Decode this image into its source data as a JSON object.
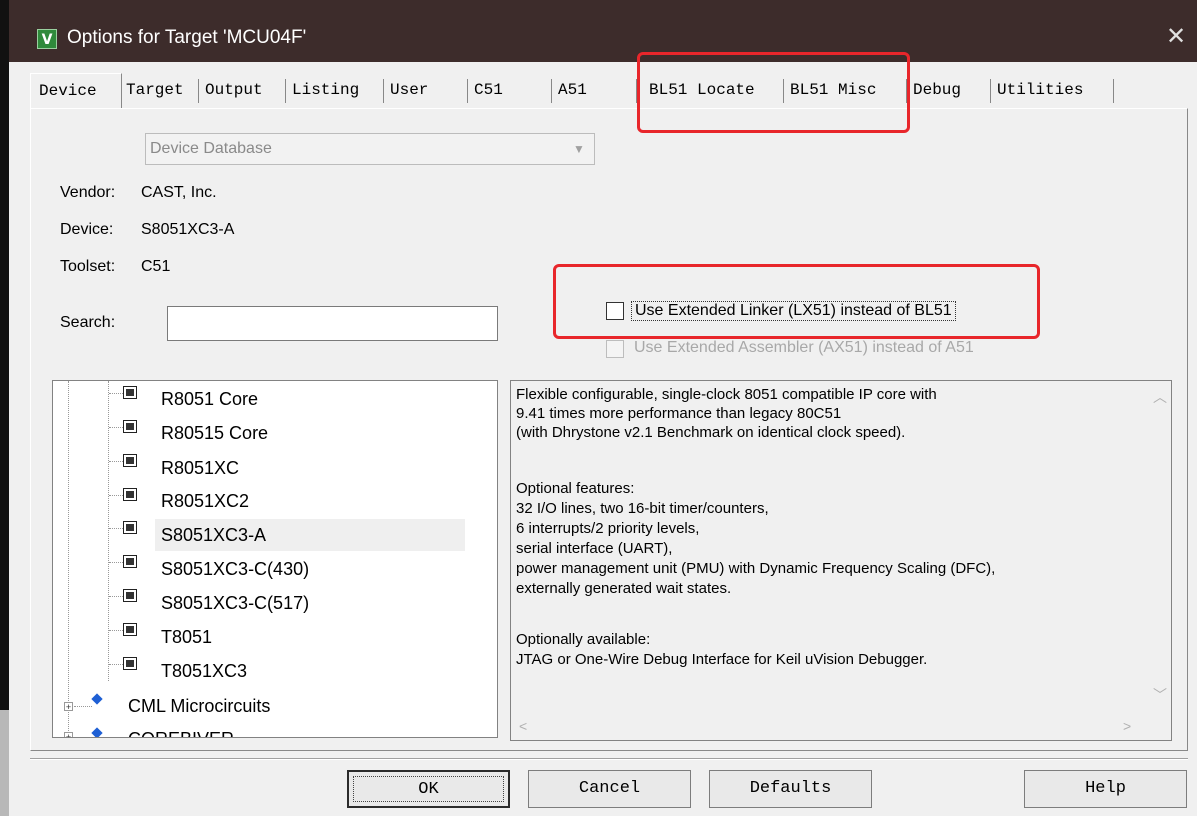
{
  "window": {
    "title": "Options for Target 'MCU04F'",
    "close_glyph": "✕",
    "icon_letter": "V"
  },
  "tabs": [
    {
      "label": "Device"
    },
    {
      "label": "Target"
    },
    {
      "label": "Output"
    },
    {
      "label": "Listing"
    },
    {
      "label": "User"
    },
    {
      "label": "C51"
    },
    {
      "label": "A51"
    },
    {
      "label": "BL51 Locate"
    },
    {
      "label": "BL51 Misc"
    },
    {
      "label": "Debug"
    },
    {
      "label": "Utilities"
    }
  ],
  "device": {
    "database_combo": "Device Database",
    "vendor_label": "Vendor:",
    "vendor_value": "CAST, Inc.",
    "device_label": "Device:",
    "device_value": "S8051XC3-A",
    "toolset_label": "Toolset:",
    "toolset_value": "C51",
    "search_label": "Search:",
    "search_value": "",
    "lx51_label": "Use Extended Linker (LX51) instead of BL51",
    "ax51_label": "Use Extended Assembler (AX51) instead of A51"
  },
  "tree": {
    "items": [
      "R8051 Core",
      "R80515 Core",
      "R8051XC",
      "R8051XC2",
      "S8051XC3-A",
      "S8051XC3-C(430)",
      "S8051XC3-C(517)",
      "T8051",
      "T8051XC3"
    ],
    "selected": "S8051XC3-A",
    "vendors": [
      "CML Microcircuits",
      "COREBIVER"
    ]
  },
  "description": [
    "Flexible configurable, single-clock 8051 compatible IP core with",
    "9.41 times more performance than legacy 80C51",
    "(with Dhrystone v2.1 Benchmark on identical clock speed).",
    "",
    "Optional features:",
    "32 I/O lines, two 16-bit timer/counters,",
    "6 interrupts/2 priority levels,",
    "serial interface (UART),",
    "power management unit (PMU) with Dynamic Frequency Scaling (DFC),",
    "externally generated wait states.",
    "",
    "Optionally available:",
    "JTAG or One-Wire Debug Interface for Keil uVision Debugger."
  ],
  "buttons": {
    "ok": "OK",
    "cancel": "Cancel",
    "defaults": "Defaults",
    "help": "Help"
  },
  "colors": {
    "titlebar": "#3d2c2b",
    "annotation": "#e8262b",
    "selection": "#efefef"
  }
}
